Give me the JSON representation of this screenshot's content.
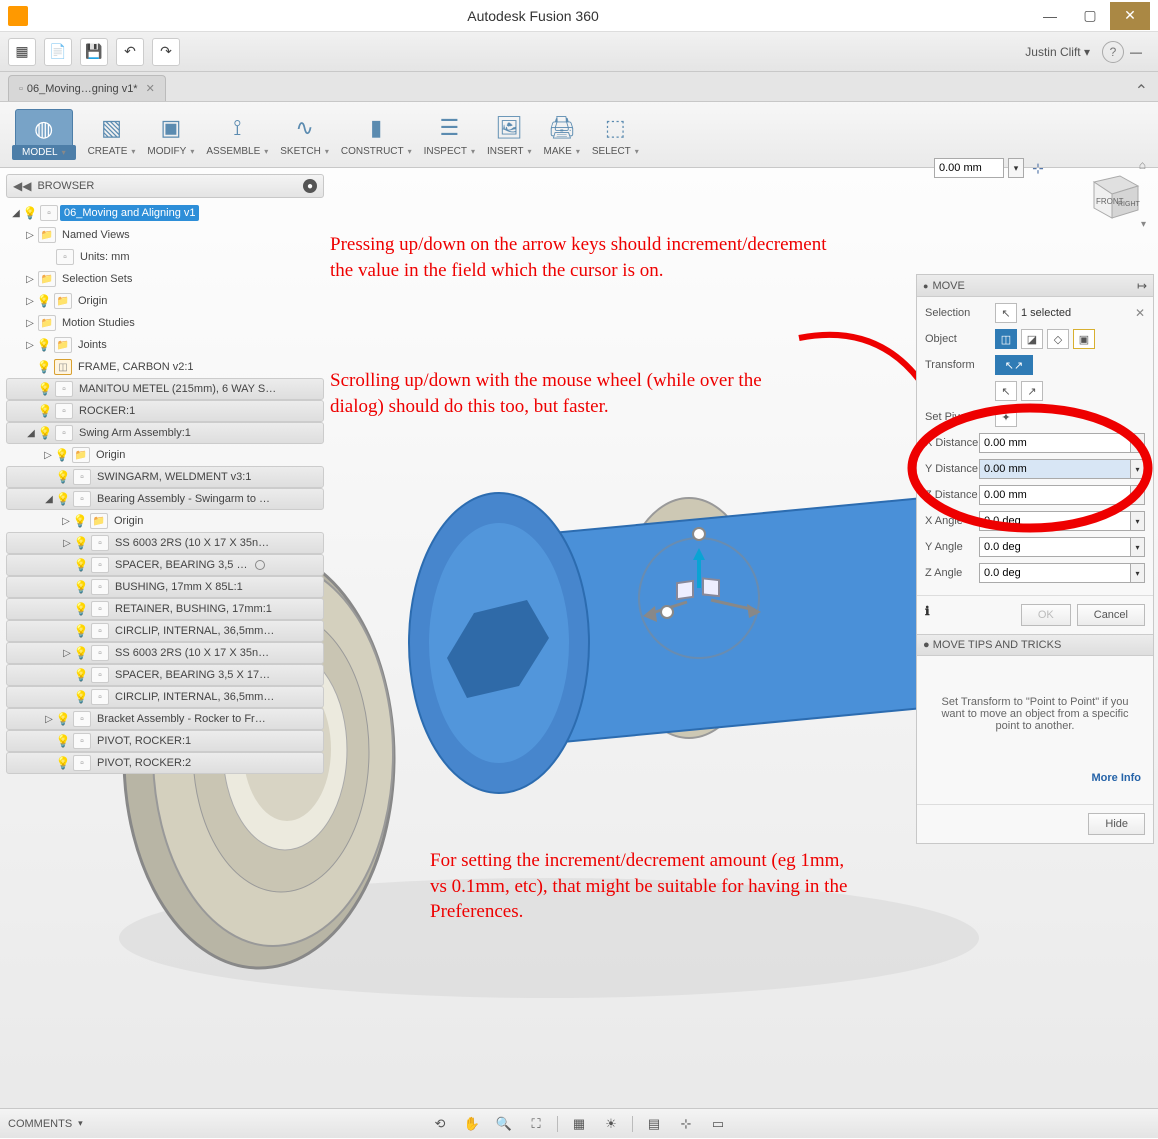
{
  "window": {
    "title": "Autodesk Fusion 360"
  },
  "user": {
    "name": "Justin Clift"
  },
  "doctab": {
    "label": "06_Moving…gning v1*"
  },
  "ribbon": {
    "model": "MODEL",
    "create": "CREATE",
    "modify": "MODIFY",
    "assemble": "ASSEMBLE",
    "sketch": "SKETCH",
    "construct": "CONSTRUCT",
    "inspect": "INSPECT",
    "insert": "INSERT",
    "make": "MAKE",
    "select": "SELECT"
  },
  "grid_value": "0.00 mm",
  "browser": {
    "title": "BROWSER",
    "root": "06_Moving and Aligning v1",
    "items": {
      "named_views": "Named Views",
      "units": "Units: mm",
      "selection_sets": "Selection Sets",
      "origin": "Origin",
      "motion_studies": "Motion Studies",
      "joints": "Joints",
      "frame": "FRAME, CARBON v2:1",
      "manitou": "MANITOU METEL (215mm), 6 WAY S…",
      "rocker": "ROCKER:1",
      "swing_arm": "Swing Arm Assembly:1",
      "origin2": "Origin",
      "swingarm_weld": "SWINGARM, WELDMENT v3:1",
      "bearing_assy": "Bearing Assembly - Swingarm to …",
      "origin3": "Origin",
      "ss6003_1": "SS 6003 2RS (10 X 17 X 35n…",
      "spacer1": "SPACER, BEARING 3,5 …",
      "bushing": "BUSHING, 17mm X 85L:1",
      "retainer": "RETAINER, BUSHING, 17mm:1",
      "circlip1": "CIRCLIP, INTERNAL, 36,5mm…",
      "ss6003_2": "SS 6003 2RS (10 X 17 X 35n…",
      "spacer2": "SPACER, BEARING 3,5 X 17…",
      "circlip2": "CIRCLIP, INTERNAL, 36,5mm…",
      "bracket": "Bracket Assembly - Rocker to Fr…",
      "pivot1": "PIVOT, ROCKER:1",
      "pivot2": "PIVOT, ROCKER:2"
    }
  },
  "annotations": {
    "a1": "Pressing up/down on the arrow keys should increment/decrement the value in the field which the cursor is on.",
    "a2": "Scrolling up/down with the mouse wheel (while over the dialog) should do this too, but faster.",
    "a3": "For setting the increment/decrement amount (eg 1mm, vs 0.1mm, etc), that might be suitable for having in the Preferences."
  },
  "move_panel": {
    "title": "MOVE",
    "selection_label": "Selection",
    "selection_value": "1 selected",
    "object_label": "Object",
    "transform_label": "Transform",
    "setpivot_label": "Set Pivot",
    "fields": {
      "x_dist": {
        "label": "X Distance",
        "value": "0.00 mm"
      },
      "y_dist": {
        "label": "Y Distance",
        "value": "0.00 mm"
      },
      "z_dist": {
        "label": "Z Distance",
        "value": "0.00 mm"
      },
      "x_ang": {
        "label": "X Angle",
        "value": "0.0 deg"
      },
      "y_ang": {
        "label": "Y Angle",
        "value": "0.0 deg"
      },
      "z_ang": {
        "label": "Z Angle",
        "value": "0.0 deg"
      }
    },
    "ok": "OK",
    "cancel": "Cancel",
    "tips_title": "MOVE TIPS AND TRICKS",
    "tips_text": "Set Transform to \"Point to Point\" if you want to move an object from a specific point to another.",
    "more": "More Info",
    "hide": "Hide"
  },
  "viewcube": {
    "front": "FRONT",
    "right": "RIGHT"
  },
  "footer": {
    "comments": "COMMENTS"
  }
}
